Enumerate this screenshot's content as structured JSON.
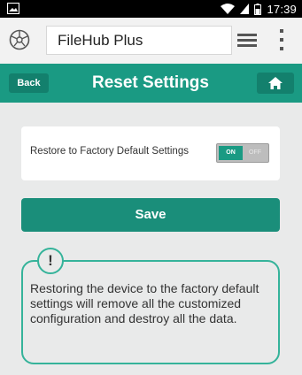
{
  "status_bar": {
    "time": "17:39"
  },
  "browser": {
    "url_text": "FileHub Plus"
  },
  "header": {
    "back_label": "Back",
    "title": "Reset Settings"
  },
  "setting": {
    "label": "Restore to Factory Default Settings",
    "toggle_on_label": "ON",
    "toggle_off_label": "OFF",
    "toggle_state": "on"
  },
  "actions": {
    "save_label": "Save"
  },
  "warning": {
    "icon_glyph": "!",
    "text": "Restoring the device to the factory default settings will remove all the customized configuration and destroy all the data."
  },
  "colors": {
    "accent": "#1a9a83",
    "accent_dark": "#13806d",
    "background": "#e9eaea",
    "warning_border": "#35b39a"
  }
}
